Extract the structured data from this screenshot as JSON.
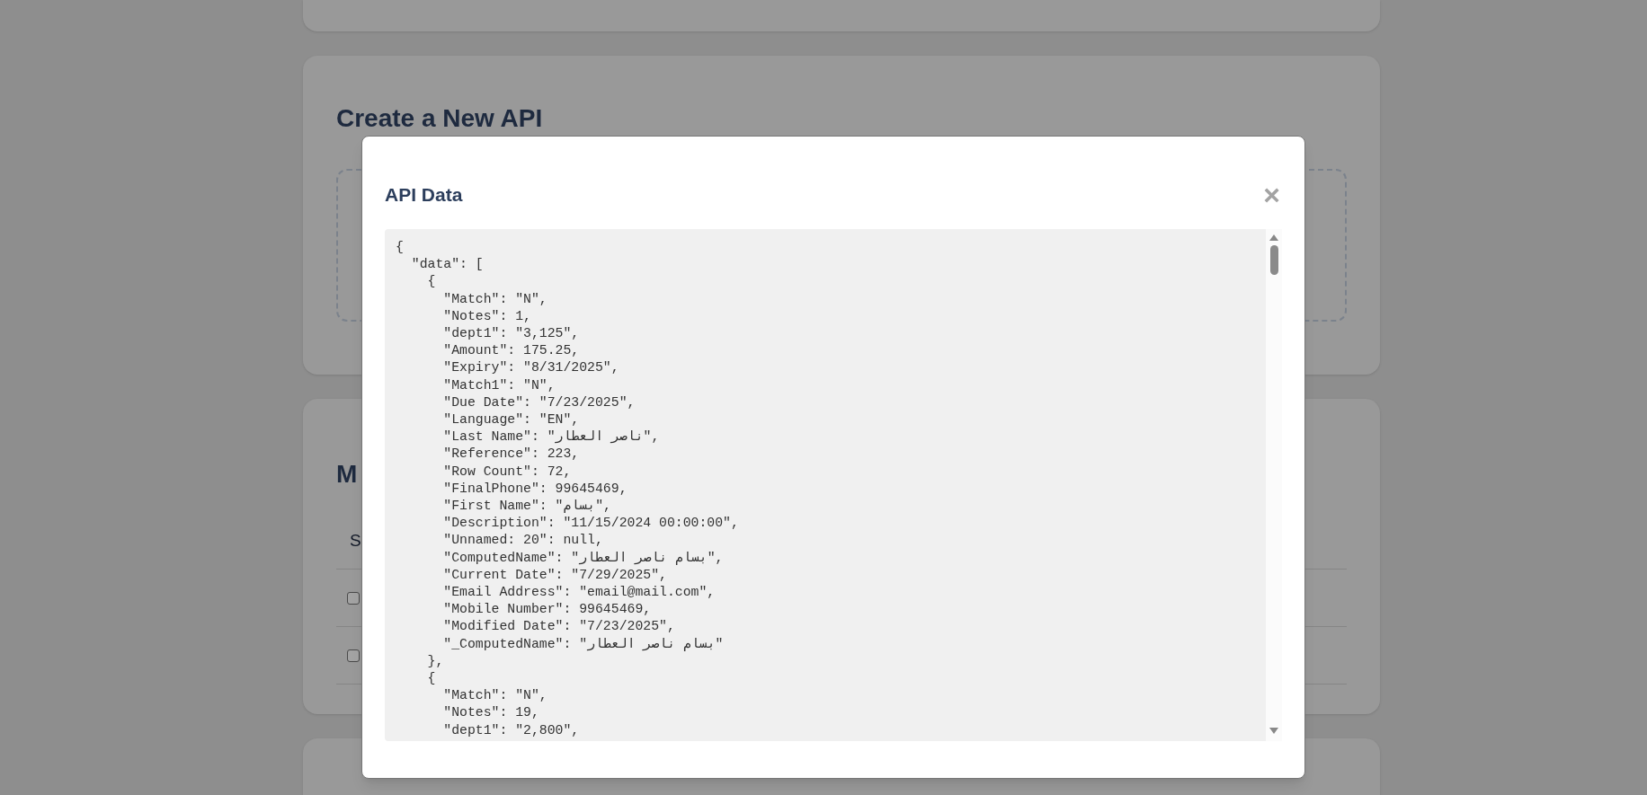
{
  "background": {
    "create_api": {
      "heading": "Create a New API"
    },
    "list_section": {
      "heading": "M",
      "column_header": "S",
      "rows": [
        {
          "checked": false
        },
        {
          "checked": false
        }
      ]
    }
  },
  "modal": {
    "title": "API Data",
    "close_label": "×",
    "code_lines": [
      "{",
      "  \"data\": [",
      "    {",
      "      \"Match\": \"N\",",
      "      \"Notes\": 1,",
      "      \"dept1\": \"3,125\",",
      "      \"Amount\": 175.25,",
      "      \"Expiry\": \"8/31/2025\",",
      "      \"Match1\": \"N\",",
      "      \"Due Date\": \"7/23/2025\",",
      "      \"Language\": \"EN\",",
      "      \"Last Name\": \"ناصر العطار\",",
      "      \"Reference\": 223,",
      "      \"Row Count\": 72,",
      "      \"FinalPhone\": 99645469,",
      "      \"First Name\": \"بسام\",",
      "      \"Description\": \"11/15/2024 00:00:00\",",
      "      \"Unnamed: 20\": null,",
      "      \"ComputedName\": \"بسام ناصر العطار\",",
      "      \"Current Date\": \"7/29/2025\",",
      "      \"Email Address\": \"email@mail.com\",",
      "      \"Mobile Number\": 99645469,",
      "      \"Modified Date\": \"7/23/2025\",",
      "      \"_ComputedName\": \"بسام ناصر العطار\"",
      "    },",
      "    {",
      "      \"Match\": \"N\",",
      "      \"Notes\": 19,",
      "      \"dept1\": \"2,800\","
    ]
  }
}
